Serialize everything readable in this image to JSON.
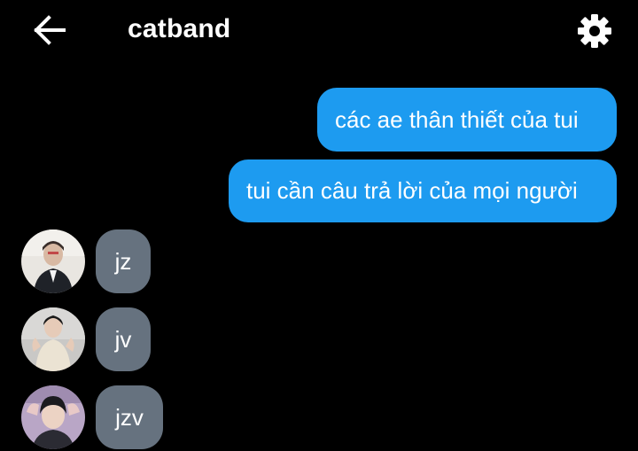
{
  "header": {
    "title": "catband",
    "back_icon": "arrow-left-icon",
    "settings_icon": "gear-icon"
  },
  "messages_sent": [
    {
      "text": "các ae thân thiết của tui"
    },
    {
      "text": "tui cần câu trả lời của mọi người"
    }
  ],
  "messages_received": [
    {
      "text": "jz",
      "avatar": "avatar-photo"
    },
    {
      "text": "jv",
      "avatar": "avatar-photo"
    },
    {
      "text": "jzv",
      "avatar": "avatar-photo"
    }
  ],
  "colors": {
    "background": "#000000",
    "sent_bubble": "#1d9bf0",
    "received_bubble": "#66727f",
    "text": "#ffffff"
  }
}
